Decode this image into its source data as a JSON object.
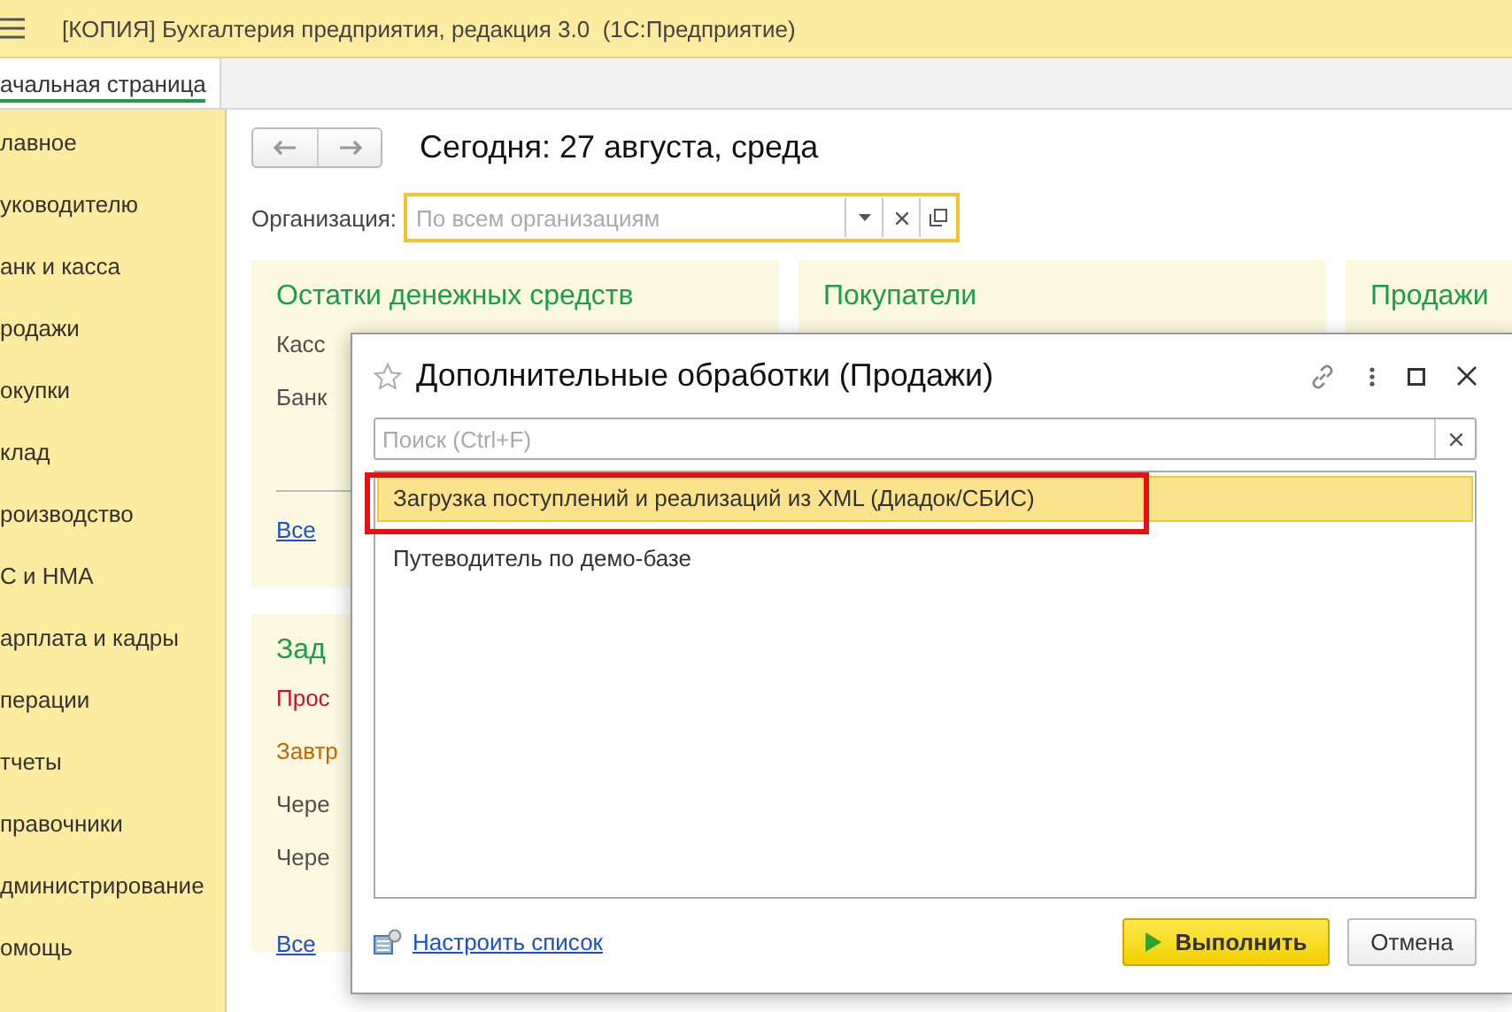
{
  "window": {
    "title": "[КОПИЯ] Бухгалтерия предприятия, редакция 3.0  (1С:Предприятие)"
  },
  "tabs": [
    {
      "label": "ачальная страница",
      "selected": true
    }
  ],
  "sidebar": {
    "items": [
      "лавное",
      "уководителю",
      "анк и касса",
      "родажи",
      "окупки",
      "клад",
      "роизводство",
      "С и НМА",
      "арплата и кадры",
      "перации",
      "тчеты",
      "правочники",
      "дминистрирование",
      "омощь"
    ]
  },
  "home": {
    "date_title": "Сегодня: 27 августа, среда",
    "organization": {
      "label": "Организация:",
      "placeholder": "По всем организациям"
    },
    "panels": [
      {
        "title": "Остатки денежных средств",
        "rows": [
          {
            "text": "Касс",
            "color": "#4d4d4d"
          },
          {
            "text": "Банк",
            "color": "#4d4d4d"
          }
        ],
        "link": "Все"
      },
      {
        "title": "Покупатели"
      },
      {
        "title": "Продажи"
      },
      {
        "title": "Зад",
        "rows": [
          {
            "text": "Прос",
            "color": "#c8102e"
          },
          {
            "text": "Завтр",
            "color": "#c86400"
          },
          {
            "text": "Чере",
            "color": "#4d4d4d"
          },
          {
            "text": "Чере",
            "color": "#4d4d4d"
          }
        ],
        "link": "Все"
      }
    ]
  },
  "dialog": {
    "title": "Дополнительные обработки (Продажи)",
    "search": {
      "placeholder": "Поиск (Ctrl+F)"
    },
    "items": [
      {
        "label": "Загрузка поступлений и реализаций из XML (Диадок/СБИС)",
        "selected": true
      },
      {
        "label": "Путеводитель по демо-базе",
        "selected": false
      }
    ],
    "settings_link": "Настроить список",
    "buttons": [
      {
        "label": "Выполнить",
        "kind": "primary"
      },
      {
        "label": "Отмена",
        "kind": "secondary"
      }
    ]
  }
}
